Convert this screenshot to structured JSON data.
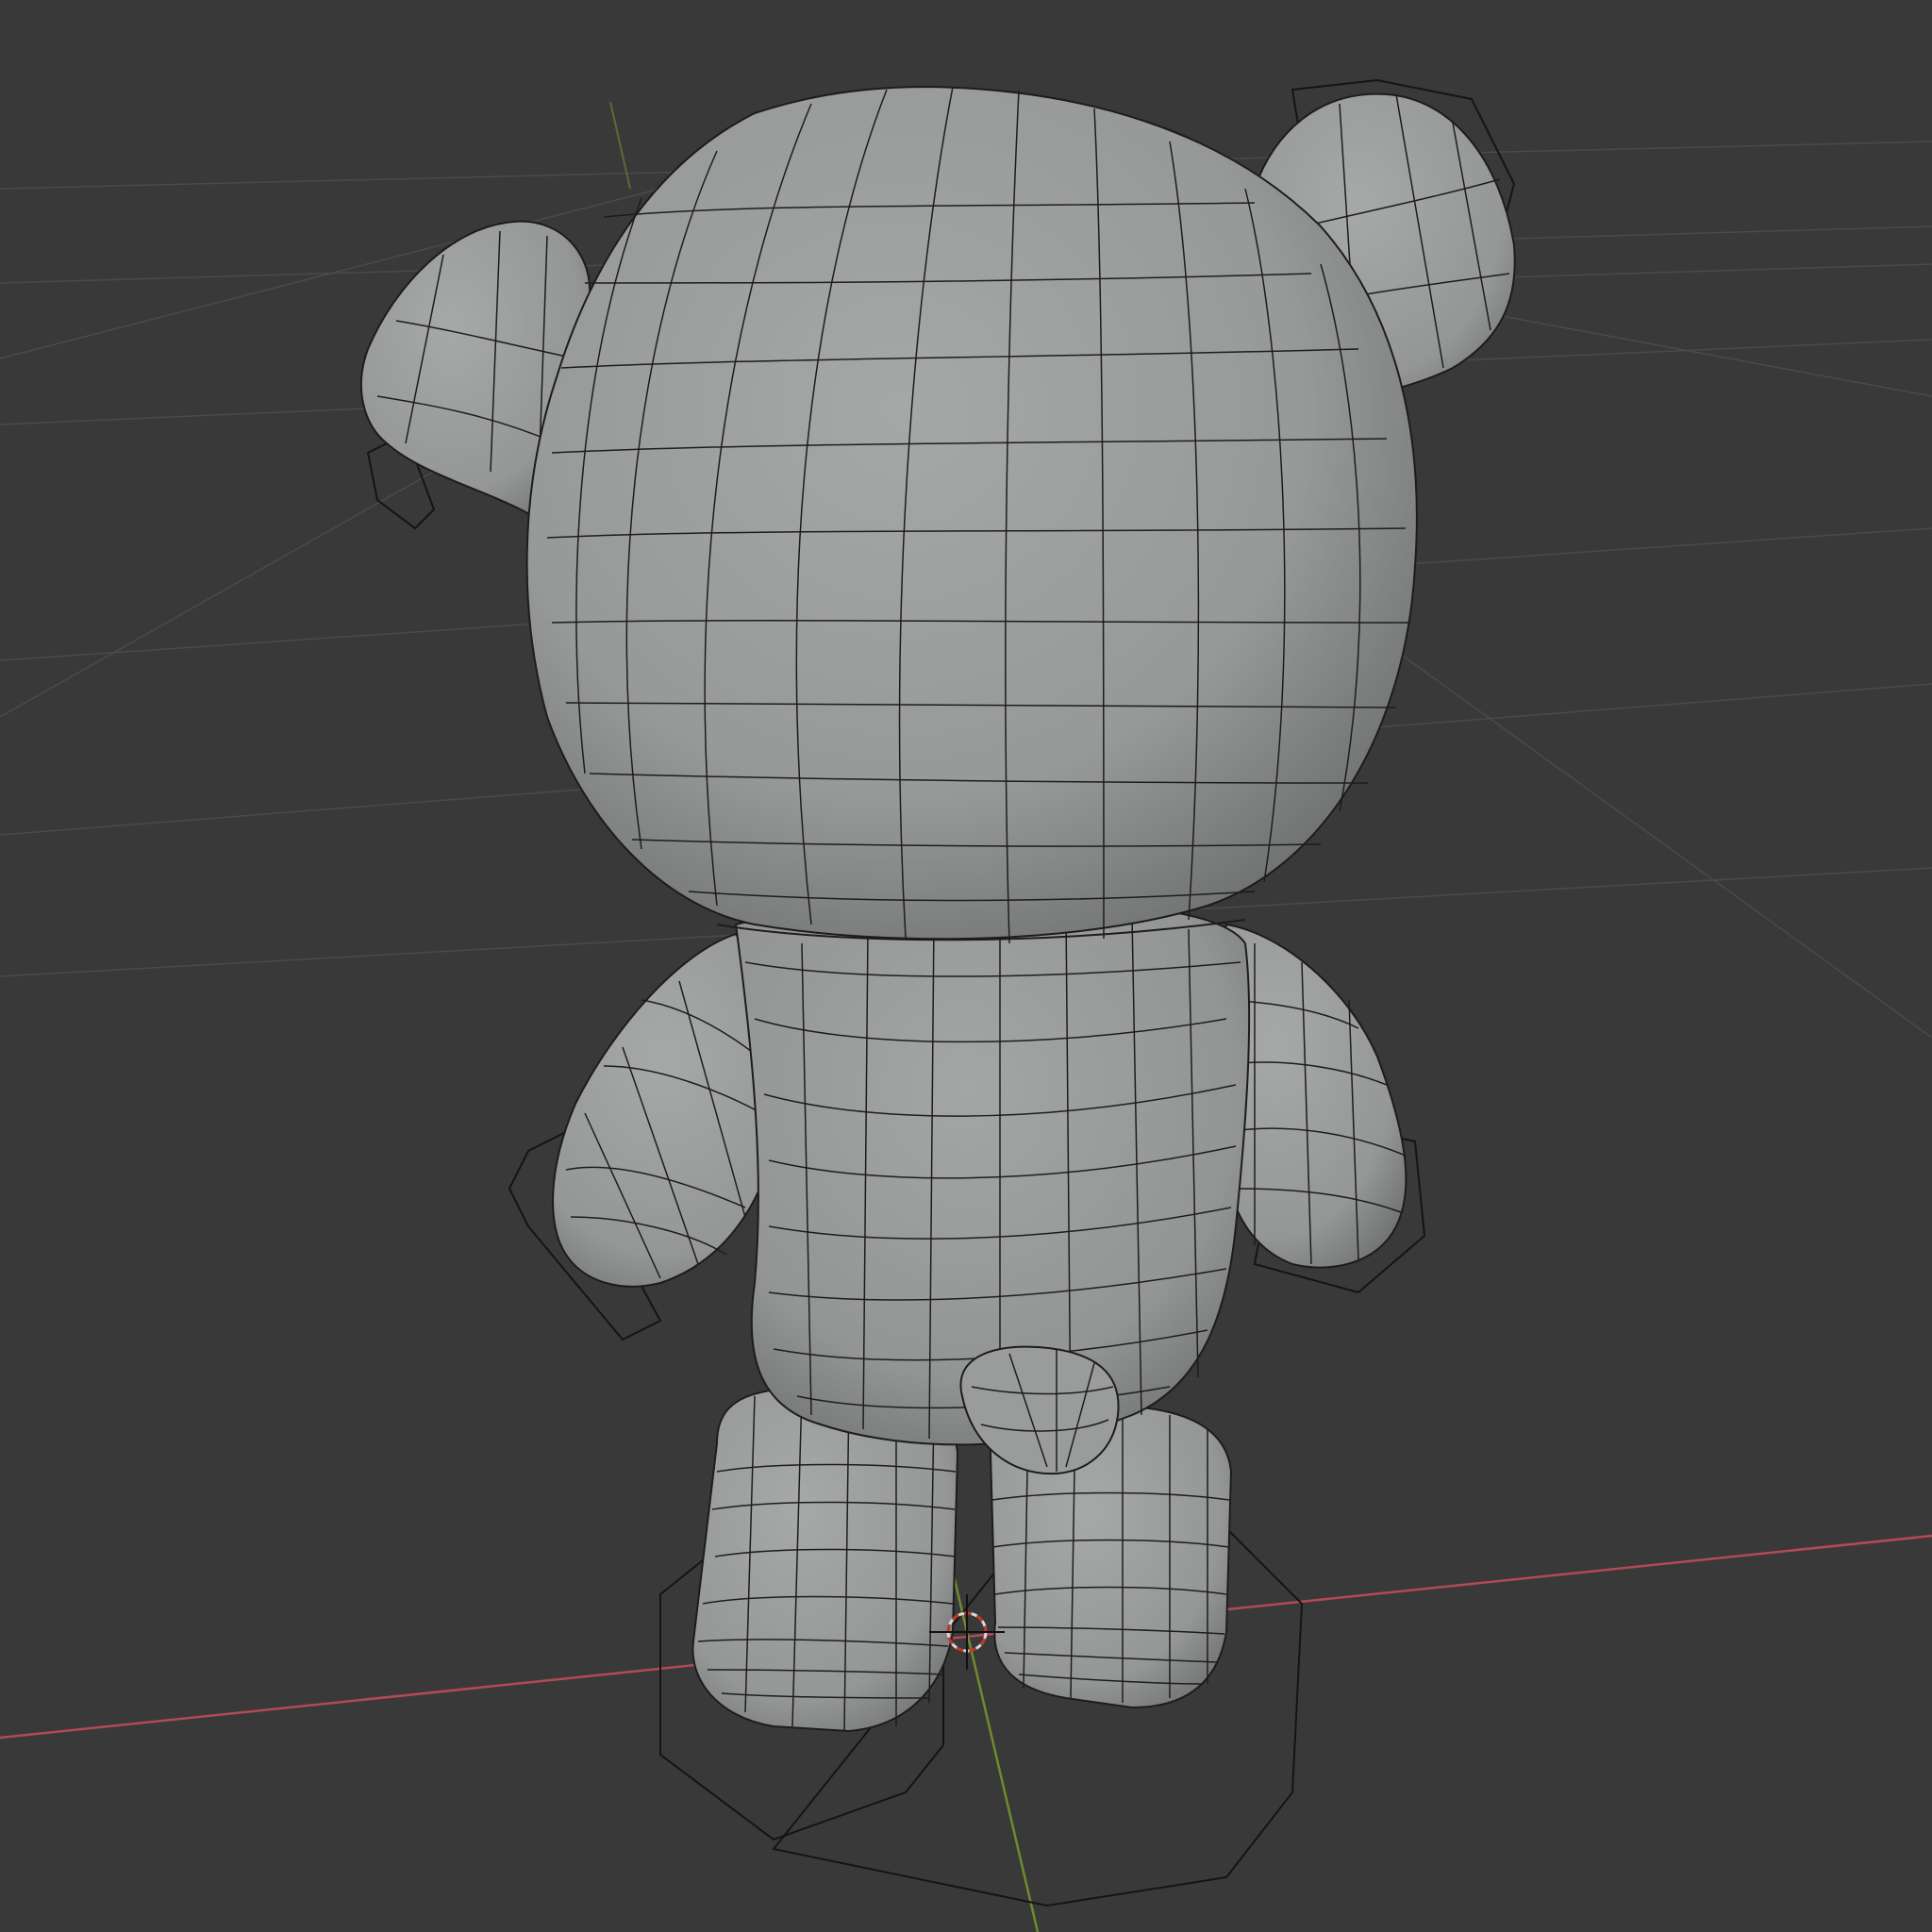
{
  "viewport": {
    "mode": "3d-viewport",
    "background_color": "#393939",
    "grid_color": "#4a4a4a",
    "x_axis_color": "#b34a55",
    "y_axis_color": "#6f8a2f",
    "mesh_color": "#8f9190",
    "wire_color": "#1c1c1c",
    "cage_color": "#141414"
  },
  "scene": {
    "object": "teddy-bear-mesh",
    "parts": [
      "head",
      "left-ear",
      "right-ear",
      "torso",
      "left-arm",
      "right-arm",
      "tail",
      "left-leg",
      "right-leg"
    ],
    "cursor_icon": "3d-cursor-icon"
  }
}
